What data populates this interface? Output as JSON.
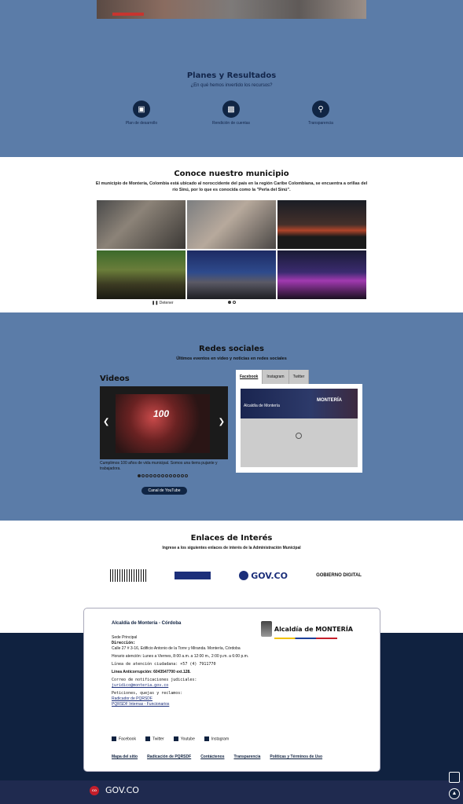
{
  "planes": {
    "title": "Planes y Resultados",
    "subtitle": "¿En qué hemos invertido los recursos?",
    "items": [
      {
        "label": "Plan de desarrollo",
        "icon": "briefcase-icon"
      },
      {
        "label": "Rendición de cuentas",
        "icon": "signal-bars-icon"
      },
      {
        "label": "Transparencia",
        "icon": "search-icon"
      }
    ]
  },
  "conoce": {
    "title": "Conoce nuestro municipio",
    "description": "El municipio de Montería, Colombia está ubicado al noroccidente del país en la región Caribe Colombiana, se encuentra a orillas del río Sinú, por lo que es conocida como la \"Perla del Sinú\".",
    "pause_label": "Detener"
  },
  "redes": {
    "title": "Redes sociales",
    "subtitle": "Últimos eventos en video y noticias en redes sociales",
    "videos_title": "Videos",
    "video_caption": "Cumplimos 100 años de vida municipal. Somos una tierra pujante y trabajadora.",
    "youtube_button": "Canal de YouTube",
    "tabs": [
      "Facebook",
      "Instagram",
      "Twitter"
    ],
    "fb_name": "Alcaldía de Montería",
    "fb_brand": "MONTERÍA"
  },
  "enlaces": {
    "title": "Enlaces de Interés",
    "subtitle": "Ingrese a los siguientes enlaces de interés de la Administración Municipal",
    "gov_label": "GOV.CO",
    "gobierno_digital": "GOBIERNO DIGITAL"
  },
  "footer": {
    "title": "Alcaldía de Montería - Córdoba",
    "logo_text": "Alcaldía de MONTERÍA",
    "sede": "Sede Principal",
    "direccion_label": "Dirección:",
    "direccion": "Calle 27 # 3-16, Edificio Antonio de la Torre y Miranda. Montería, Córdoba",
    "horario": "Horario atención: Lunes a Viernes, 8:00 a.m. a 12:00 m., 2:00 p.m. a 6:00 p.m.",
    "linea_atencion": "Línea de atención ciudadana: +57 (4) 7911770",
    "linea_anticorrupcion": "Línea Anticorrupción: 6043547700 ext.128.",
    "correo_label": "Correo de notificaciones judiciales:",
    "correo": "juridico@monteria.gov.co",
    "pqrs_label": "Peticiones, quejas y reclamos:",
    "pqrs_link": "Radicador de PQRSDF",
    "pqrs_link2": "PQRSDF Internas - Funcionarios",
    "social": [
      "Facebook",
      "Twitter",
      "Youtube",
      "Instagram"
    ],
    "links": [
      "Mapa del sitio",
      "Radicación de PQRSDF",
      "Contáctenos",
      "Transparencia",
      "Políticas y Términos de Uso"
    ]
  },
  "bottom": {
    "co_label": "CO",
    "gov_label": "GOV.CO"
  }
}
